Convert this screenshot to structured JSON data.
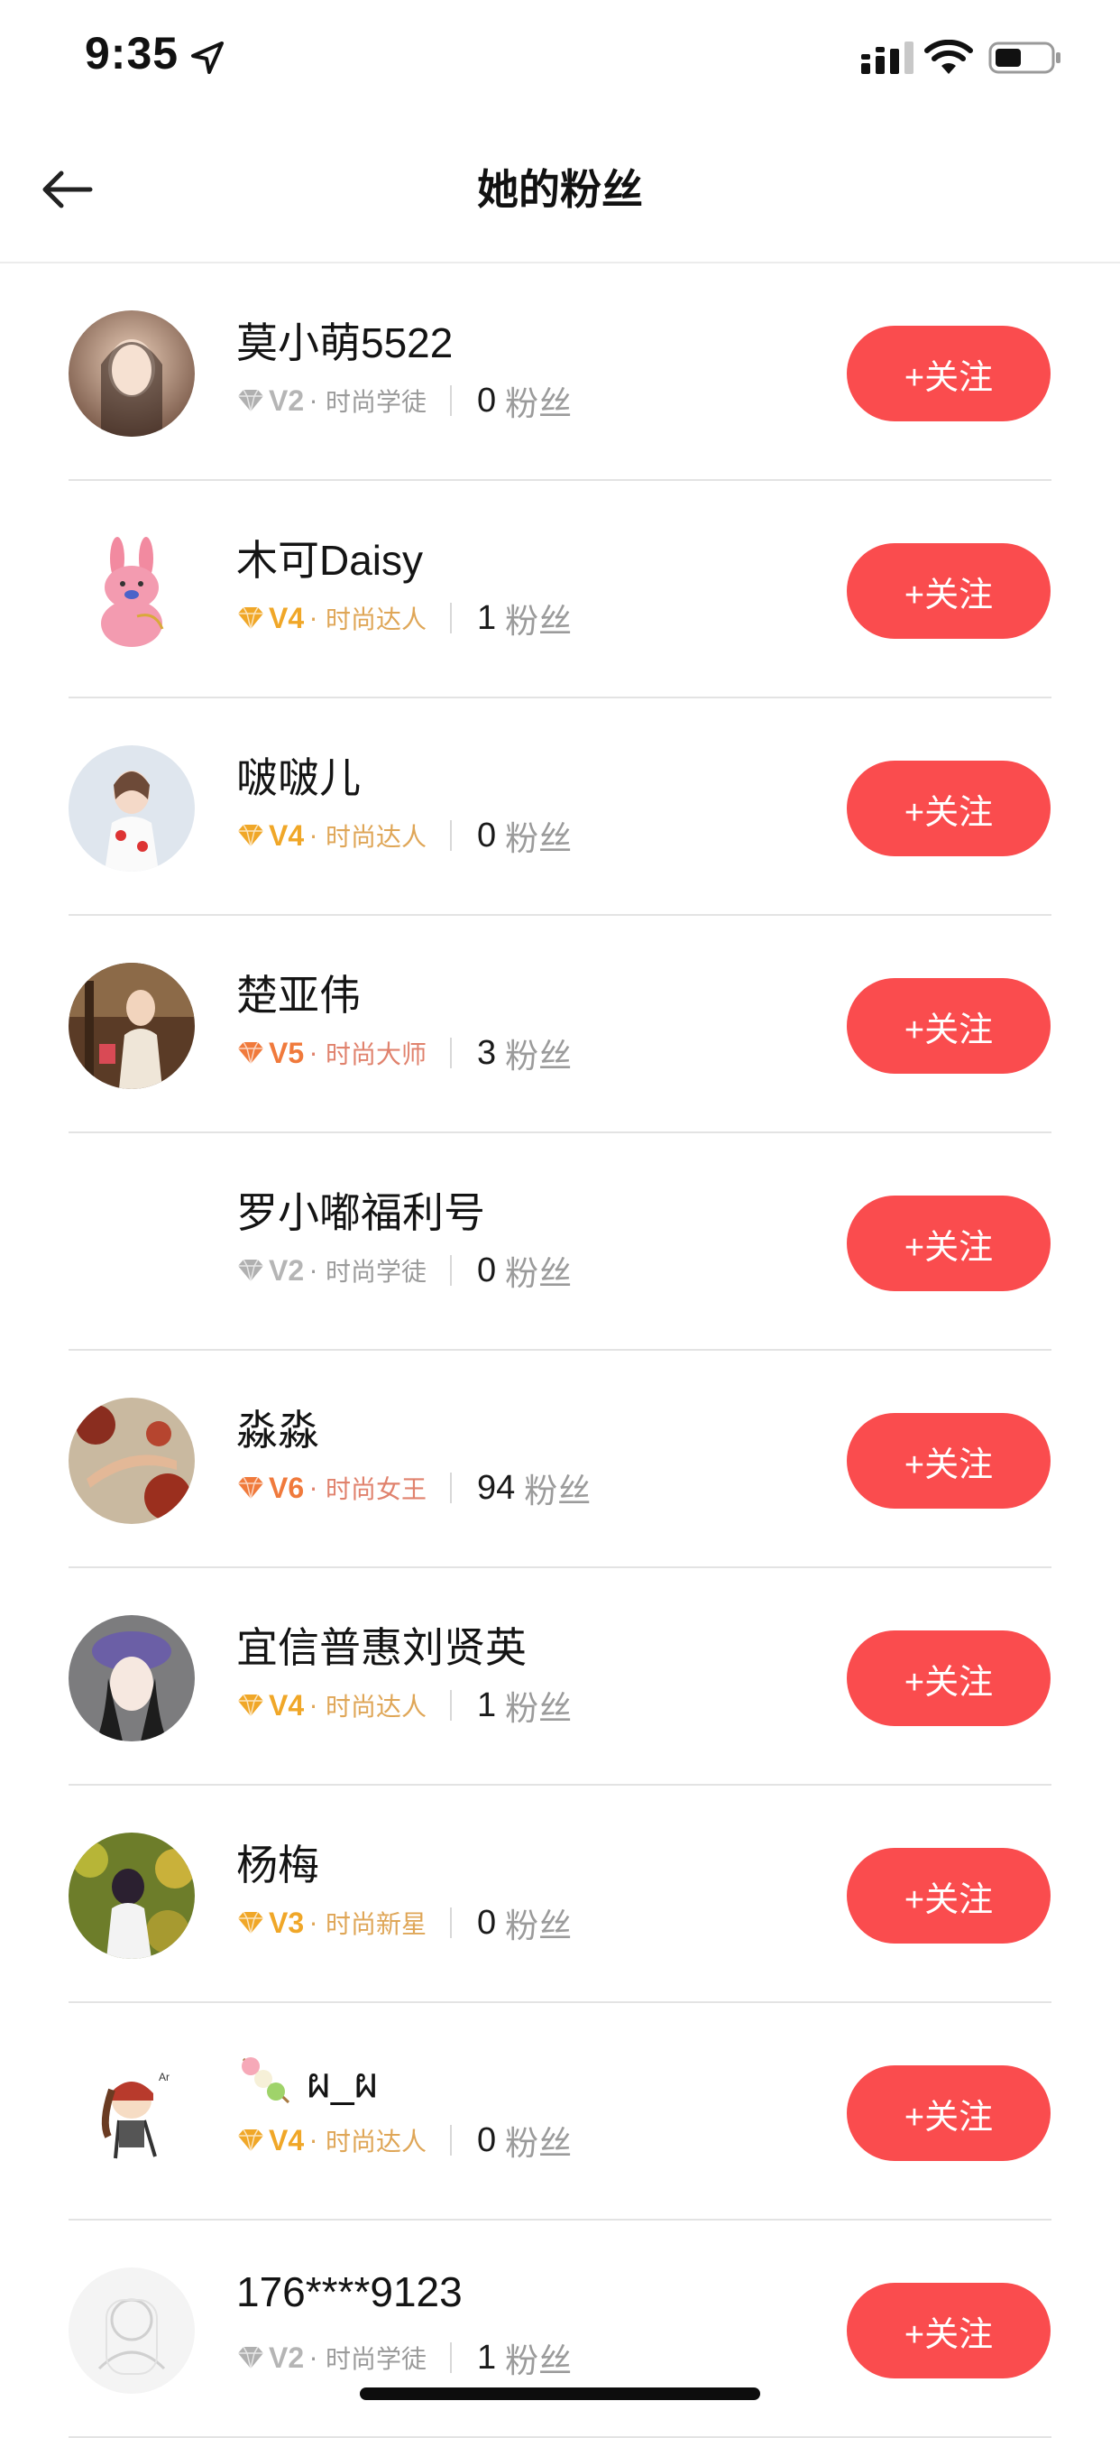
{
  "status_bar": {
    "time": "9:35"
  },
  "nav": {
    "title": "她的粉丝",
    "back_icon": "arrow-left-icon"
  },
  "colors": {
    "follow_button": "#fa4c4e",
    "level_gray": "#b0b0b0",
    "level_gold": "#f0a728",
    "level_orange": "#f07a3c",
    "level_title_gold": "#dfa657",
    "level_title_orange": "#e0826d"
  },
  "follow_label": "+关注",
  "fans_label": "粉丝",
  "users": [
    {
      "name": "莫小萌5522",
      "level": "V2",
      "title": "· 时尚学徒",
      "fans": "0",
      "tier": "gray",
      "avatar": "photo-avatar"
    },
    {
      "name": "木可Daisy",
      "level": "V4",
      "title": "· 时尚达人",
      "fans": "1",
      "tier": "gold",
      "avatar": "pink-rabbit-avatar"
    },
    {
      "name": "啵啵儿",
      "level": "V4",
      "title": "· 时尚达人",
      "fans": "0",
      "tier": "gold",
      "avatar": "photo-avatar"
    },
    {
      "name": "楚亚伟",
      "level": "V5",
      "title": "· 时尚大师",
      "fans": "3",
      "tier": "orange",
      "avatar": "photo-avatar"
    },
    {
      "name": "罗小嘟福利号",
      "level": "V2",
      "title": "· 时尚学徒",
      "fans": "0",
      "tier": "gray",
      "avatar": "blank-avatar"
    },
    {
      "name": "淼淼",
      "level": "V6",
      "title": "· 时尚女王",
      "fans": "94",
      "tier": "orange",
      "avatar": "photo-avatar"
    },
    {
      "name": "宜信普惠刘贤英",
      "level": "V4",
      "title": "· 时尚达人",
      "fans": "1",
      "tier": "gold",
      "avatar": "photo-avatar"
    },
    {
      "name": "杨梅",
      "level": "V3",
      "title": "· 时尚新星",
      "fans": "0",
      "tier": "gold",
      "avatar": "photo-avatar"
    },
    {
      "name": "ผ_ผ",
      "level": "V4",
      "title": "· 时尚达人",
      "fans": "0",
      "tier": "gold",
      "avatar": "cartoon-avatar",
      "name_emoji": "dango-icon"
    },
    {
      "name": "176****9123",
      "level": "V2",
      "title": "· 时尚学徒",
      "fans": "1",
      "tier": "gray",
      "avatar": "default-avatar"
    }
  ]
}
